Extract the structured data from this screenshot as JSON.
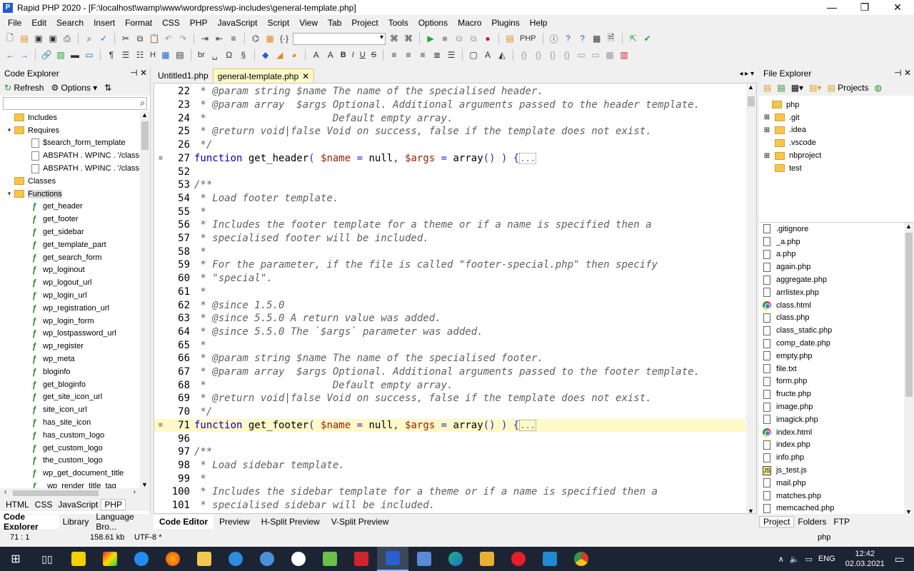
{
  "window": {
    "title": "Rapid PHP 2020 - [F:\\localhost\\wamp\\www\\wordpress\\wp-includes\\general-template.php]"
  },
  "menu": [
    "File",
    "Edit",
    "Search",
    "Insert",
    "Format",
    "CSS",
    "PHP",
    "JavaScript",
    "Script",
    "View",
    "Tab",
    "Project",
    "Tools",
    "Options",
    "Macro",
    "Plugins",
    "Help"
  ],
  "toolbar": {
    "php_button": "PHP",
    "search_combo_value": "",
    "format_bold": "B",
    "format_italic": "I",
    "format_underline": "U",
    "format_strike": "S",
    "br_tag": "br",
    "heading": "H"
  },
  "code_explorer": {
    "title": "Code Explorer",
    "refresh_label": "Refresh",
    "options_label": "Options",
    "search_value": "",
    "tree": [
      {
        "label": "Includes",
        "type": "folder",
        "level": 0,
        "expander": ""
      },
      {
        "label": "Requires",
        "type": "folder",
        "level": 0,
        "expander": "▾"
      },
      {
        "label": "$search_form_template",
        "type": "file",
        "level": 1,
        "expander": ""
      },
      {
        "label": "ABSPATH . WPINC . '/class-w",
        "type": "file",
        "level": 1,
        "expander": ""
      },
      {
        "label": "ABSPATH . WPINC . '/class-w",
        "type": "file",
        "level": 1,
        "expander": ""
      },
      {
        "label": "Classes",
        "type": "folder",
        "level": 0,
        "expander": ""
      },
      {
        "label": "Functions",
        "type": "folder",
        "level": 0,
        "expander": "▾",
        "selected": true
      },
      {
        "label": "get_header",
        "type": "fn",
        "level": 1
      },
      {
        "label": "get_footer",
        "type": "fn",
        "level": 1
      },
      {
        "label": "get_sidebar",
        "type": "fn",
        "level": 1
      },
      {
        "label": "get_template_part",
        "type": "fn",
        "level": 1
      },
      {
        "label": "get_search_form",
        "type": "fn",
        "level": 1
      },
      {
        "label": "wp_loginout",
        "type": "fn",
        "level": 1
      },
      {
        "label": "wp_logout_url",
        "type": "fn",
        "level": 1
      },
      {
        "label": "wp_login_url",
        "type": "fn",
        "level": 1
      },
      {
        "label": "wp_registration_url",
        "type": "fn",
        "level": 1
      },
      {
        "label": "wp_login_form",
        "type": "fn",
        "level": 1
      },
      {
        "label": "wp_lostpassword_url",
        "type": "fn",
        "level": 1
      },
      {
        "label": "wp_register",
        "type": "fn",
        "level": 1
      },
      {
        "label": "wp_meta",
        "type": "fn",
        "level": 1
      },
      {
        "label": "bloginfo",
        "type": "fn",
        "level": 1
      },
      {
        "label": "get_bloginfo",
        "type": "fn",
        "level": 1
      },
      {
        "label": "get_site_icon_url",
        "type": "fn",
        "level": 1
      },
      {
        "label": "site_icon_url",
        "type": "fn",
        "level": 1
      },
      {
        "label": "has_site_icon",
        "type": "fn",
        "level": 1
      },
      {
        "label": "has_custom_logo",
        "type": "fn",
        "level": 1
      },
      {
        "label": "get_custom_logo",
        "type": "fn",
        "level": 1
      },
      {
        "label": "the_custom_logo",
        "type": "fn",
        "level": 1
      },
      {
        "label": "wp_get_document_title",
        "type": "fn",
        "level": 1
      },
      {
        "label": "_wp_render_title_tag",
        "type": "fn",
        "level": 1
      }
    ],
    "lang_tabs": [
      "HTML",
      "CSS",
      "JavaScript",
      "PHP"
    ],
    "active_lang": "PHP"
  },
  "editor": {
    "tabs": [
      {
        "label": "Untitled1.php",
        "active": false
      },
      {
        "label": "general-template.php",
        "active": true
      }
    ],
    "lines": [
      {
        "n": "22",
        "fold": "",
        "hl": false,
        "parts": [
          [
            "c",
            " * @param string $name The name of the specialised header."
          ]
        ]
      },
      {
        "n": "23",
        "fold": "",
        "hl": false,
        "parts": [
          [
            "c",
            " * @param array  $args Optional. Additional arguments passed to the header template."
          ]
        ]
      },
      {
        "n": "24",
        "fold": "",
        "hl": false,
        "parts": [
          [
            "c",
            " *                     Default empty array."
          ]
        ]
      },
      {
        "n": "25",
        "fold": "",
        "hl": false,
        "parts": [
          [
            "c",
            " * @return void|false Void on success, false if the template does not exist."
          ]
        ]
      },
      {
        "n": "26",
        "fold": "",
        "hl": false,
        "parts": [
          [
            "c",
            " */"
          ]
        ]
      },
      {
        "n": "27",
        "fold": "⊞",
        "hl": false,
        "parts": [
          [
            "k",
            "function"
          ],
          [
            "t",
            " get_header"
          ],
          [
            "o",
            "( "
          ],
          [
            "v",
            "$name"
          ],
          [
            "o",
            " = "
          ],
          [
            "t",
            "null"
          ],
          [
            "o",
            ", "
          ],
          [
            "v",
            "$args"
          ],
          [
            "o",
            " = "
          ],
          [
            "t",
            "array"
          ],
          [
            "o",
            "() ) {"
          ],
          [
            "f",
            "..."
          ]
        ]
      },
      {
        "n": "52",
        "fold": "",
        "hl": false,
        "parts": []
      },
      {
        "n": "53",
        "fold": "",
        "hl": false,
        "parts": [
          [
            "c",
            "/**"
          ]
        ]
      },
      {
        "n": "54",
        "fold": "",
        "hl": false,
        "parts": [
          [
            "c",
            " * Load footer template."
          ]
        ]
      },
      {
        "n": "55",
        "fold": "",
        "hl": false,
        "parts": [
          [
            "c",
            " *"
          ]
        ]
      },
      {
        "n": "56",
        "fold": "",
        "hl": false,
        "parts": [
          [
            "c",
            " * Includes the footer template for a theme or if a name is specified then a"
          ]
        ]
      },
      {
        "n": "57",
        "fold": "",
        "hl": false,
        "parts": [
          [
            "c",
            " * specialised footer will be included."
          ]
        ]
      },
      {
        "n": "58",
        "fold": "",
        "hl": false,
        "parts": [
          [
            "c",
            " *"
          ]
        ]
      },
      {
        "n": "59",
        "fold": "",
        "hl": false,
        "parts": [
          [
            "c",
            " * For the parameter, if the file is called \"footer-special.php\" then specify"
          ]
        ]
      },
      {
        "n": "60",
        "fold": "",
        "hl": false,
        "parts": [
          [
            "c",
            " * \"special\"."
          ]
        ]
      },
      {
        "n": "61",
        "fold": "",
        "hl": false,
        "parts": [
          [
            "c",
            " *"
          ]
        ]
      },
      {
        "n": "62",
        "fold": "",
        "hl": false,
        "parts": [
          [
            "c",
            " * @since 1.5.0"
          ]
        ]
      },
      {
        "n": "63",
        "fold": "",
        "hl": false,
        "parts": [
          [
            "c",
            " * @since 5.5.0 A return value was added."
          ]
        ]
      },
      {
        "n": "64",
        "fold": "",
        "hl": false,
        "parts": [
          [
            "c",
            " * @since 5.5.0 The `$args` parameter was added."
          ]
        ]
      },
      {
        "n": "65",
        "fold": "",
        "hl": false,
        "parts": [
          [
            "c",
            " *"
          ]
        ]
      },
      {
        "n": "66",
        "fold": "",
        "hl": false,
        "parts": [
          [
            "c",
            " * @param string $name The name of the specialised footer."
          ]
        ]
      },
      {
        "n": "67",
        "fold": "",
        "hl": false,
        "parts": [
          [
            "c",
            " * @param array  $args Optional. Additional arguments passed to the footer template."
          ]
        ]
      },
      {
        "n": "68",
        "fold": "",
        "hl": false,
        "parts": [
          [
            "c",
            " *                     Default empty array."
          ]
        ]
      },
      {
        "n": "69",
        "fold": "",
        "hl": false,
        "parts": [
          [
            "c",
            " * @return void|false Void on success, false if the template does not exist."
          ]
        ]
      },
      {
        "n": "70",
        "fold": "",
        "hl": false,
        "parts": [
          [
            "c",
            " */"
          ]
        ]
      },
      {
        "n": "71",
        "fold": "⊞",
        "hl": true,
        "parts": [
          [
            "k",
            "function"
          ],
          [
            "t",
            " get_footer"
          ],
          [
            "o",
            "( "
          ],
          [
            "v",
            "$name"
          ],
          [
            "o",
            " = "
          ],
          [
            "t",
            "null"
          ],
          [
            "o",
            ", "
          ],
          [
            "v",
            "$args"
          ],
          [
            "o",
            " = "
          ],
          [
            "t",
            "array"
          ],
          [
            "o",
            "() ) {"
          ],
          [
            "f",
            "..."
          ]
        ]
      },
      {
        "n": "96",
        "fold": "",
        "hl": false,
        "parts": []
      },
      {
        "n": "97",
        "fold": "",
        "hl": false,
        "parts": [
          [
            "c",
            "/**"
          ]
        ]
      },
      {
        "n": "98",
        "fold": "",
        "hl": false,
        "parts": [
          [
            "c",
            " * Load sidebar template."
          ]
        ]
      },
      {
        "n": "99",
        "fold": "",
        "hl": false,
        "parts": [
          [
            "c",
            " *"
          ]
        ]
      },
      {
        "n": "100",
        "fold": "",
        "hl": false,
        "parts": [
          [
            "c",
            " * Includes the sidebar template for a theme or if a name is specified then a"
          ]
        ]
      },
      {
        "n": "101",
        "fold": "",
        "hl": false,
        "parts": [
          [
            "c",
            " * specialised sidebar will be included."
          ]
        ]
      }
    ],
    "bottom_tabs": [
      "Code Editor",
      "Preview",
      "H-Split Preview",
      "V-Split Preview"
    ],
    "active_bottom_tab": "Code Editor"
  },
  "file_explorer": {
    "title": "File Explorer",
    "projects_label": "Projects",
    "folders": [
      {
        "label": "php",
        "level": 0,
        "expander": ""
      },
      {
        "label": ".git",
        "level": 1,
        "expander": "⊞"
      },
      {
        "label": ".idea",
        "level": 1,
        "expander": "⊞"
      },
      {
        "label": ".vscode",
        "level": 1,
        "expander": ""
      },
      {
        "label": "nbproject",
        "level": 1,
        "expander": "⊞"
      },
      {
        "label": "test",
        "level": 1,
        "expander": ""
      }
    ],
    "files": [
      {
        "label": ".gitignore",
        "kind": "doc"
      },
      {
        "label": "_a.php",
        "kind": "doc"
      },
      {
        "label": "a.php",
        "kind": "doc"
      },
      {
        "label": "again.php",
        "kind": "doc"
      },
      {
        "label": "aggregate.php",
        "kind": "doc"
      },
      {
        "label": "arrlistex.php",
        "kind": "doc"
      },
      {
        "label": "class.html",
        "kind": "chrome"
      },
      {
        "label": "class.php",
        "kind": "doc"
      },
      {
        "label": "class_static.php",
        "kind": "doc"
      },
      {
        "label": "comp_date.php",
        "kind": "doc"
      },
      {
        "label": "empty.php",
        "kind": "doc"
      },
      {
        "label": "file.txt",
        "kind": "doc"
      },
      {
        "label": "form.php",
        "kind": "doc"
      },
      {
        "label": "fructe.php",
        "kind": "doc"
      },
      {
        "label": "image.php",
        "kind": "doc"
      },
      {
        "label": "imagick.php",
        "kind": "doc"
      },
      {
        "label": "index.html",
        "kind": "chrome"
      },
      {
        "label": "index.php",
        "kind": "doc"
      },
      {
        "label": "info.php",
        "kind": "doc"
      },
      {
        "label": "js_test.js",
        "kind": "js"
      },
      {
        "label": "mail.php",
        "kind": "doc"
      },
      {
        "label": "matches.php",
        "kind": "doc"
      },
      {
        "label": "memcached.php",
        "kind": "doc"
      }
    ],
    "bottom_tabs": [
      "Project",
      "Folders",
      "FTP"
    ],
    "active_tab": "Project"
  },
  "left_bottom_tabs": [
    "Code Explorer",
    "Library",
    "Language Bro..."
  ],
  "active_left_bottom_tab": "Code Explorer",
  "status": {
    "position": "71 : 1",
    "size": "158.61 kb",
    "encoding": "UTF-8 *",
    "language": "php"
  },
  "taskbar": {
    "language": "ENG",
    "time": "12:42",
    "date": "02.03.2021"
  }
}
